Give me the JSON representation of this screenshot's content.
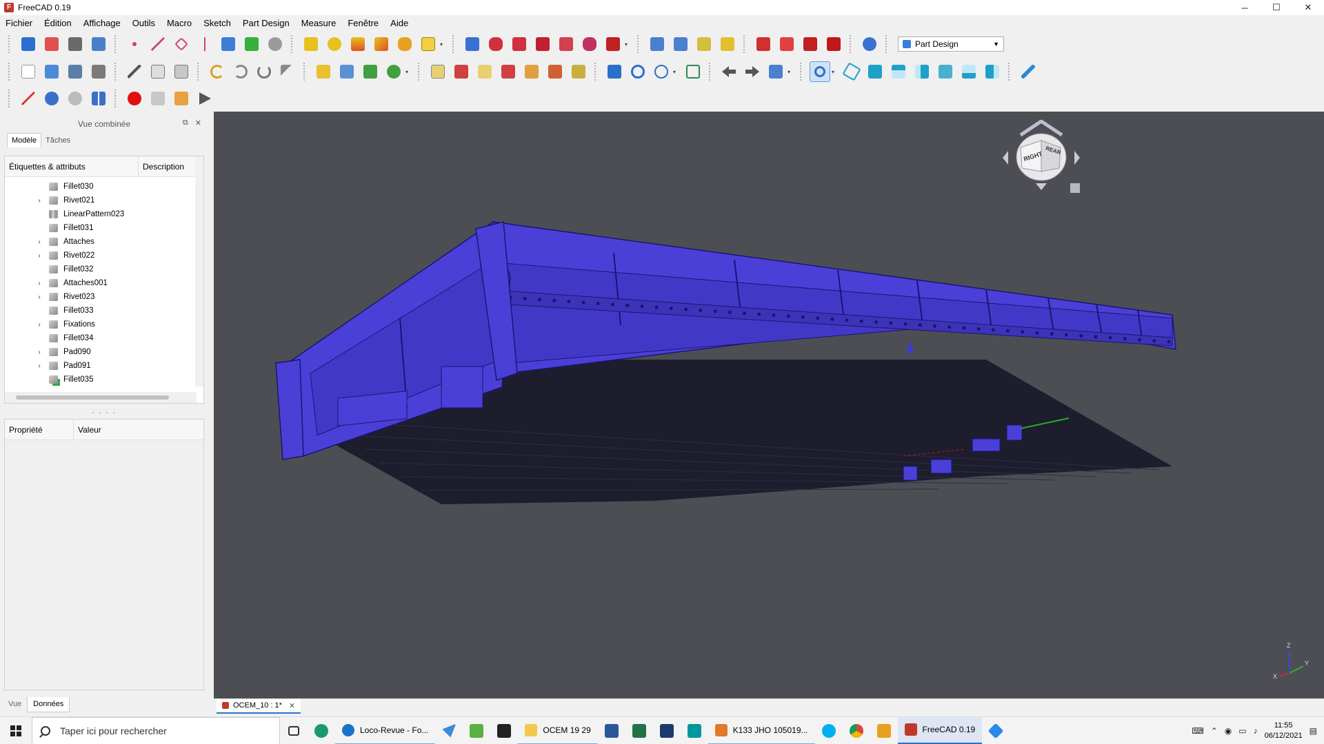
{
  "window": {
    "title": "FreeCAD 0.19",
    "min_icon": "─",
    "max_icon": "☐",
    "close_icon": "✕"
  },
  "menu": [
    "Fichier",
    "Édition",
    "Affichage",
    "Outils",
    "Macro",
    "Sketch",
    "Part Design",
    "Measure",
    "Fenêtre",
    "Aide"
  ],
  "workbench": {
    "selected": "Part Design"
  },
  "combo": {
    "title": "Vue combinée",
    "tabs": [
      "Modèle",
      "Tâches"
    ],
    "tree_columns": [
      "Étiquettes & attributs",
      "Description"
    ],
    "tree_items": [
      {
        "label": "Fillet030",
        "expandable": false,
        "icon": "fillet-icon"
      },
      {
        "label": "Rivet021",
        "expandable": true,
        "icon": "body-icon"
      },
      {
        "label": "LinearPattern023",
        "expandable": false,
        "icon": "linear-pattern-icon"
      },
      {
        "label": "Fillet031",
        "expandable": false,
        "icon": "fillet-icon"
      },
      {
        "label": "Attaches",
        "expandable": true,
        "icon": "body-icon"
      },
      {
        "label": "Rivet022",
        "expandable": true,
        "icon": "body-icon"
      },
      {
        "label": "Fillet032",
        "expandable": false,
        "icon": "fillet-icon"
      },
      {
        "label": "Attaches001",
        "expandable": true,
        "icon": "body-icon"
      },
      {
        "label": "Rivet023",
        "expandable": true,
        "icon": "body-icon"
      },
      {
        "label": "Fillet033",
        "expandable": false,
        "icon": "fillet-icon"
      },
      {
        "label": "Fixations",
        "expandable": true,
        "icon": "body-icon"
      },
      {
        "label": "Fillet034",
        "expandable": false,
        "icon": "fillet-icon"
      },
      {
        "label": "Pad090",
        "expandable": true,
        "icon": "pad-icon"
      },
      {
        "label": "Pad091",
        "expandable": true,
        "icon": "pad-icon"
      },
      {
        "label": "Fillet035",
        "expandable": false,
        "icon": "fillet-tip-icon"
      }
    ],
    "prop_columns": [
      "Propriété",
      "Valeur"
    ],
    "bottom_tabs": [
      "Vue",
      "Données"
    ]
  },
  "document_tab": {
    "label": "OCEM_10 : 1*"
  },
  "navcube": {
    "face_right": "RIGHT",
    "face_rear": "REAR"
  },
  "axis_labels": {
    "x": "X",
    "y": "Y",
    "z": "Z"
  },
  "taskbar": {
    "search_placeholder": "Taper ici pour rechercher",
    "apps": [
      {
        "label": "Loco-Revue - Fo...",
        "color": "#1a73c8"
      },
      {
        "label": "OCEM 19 29",
        "color": "#f2c94c"
      },
      {
        "label": "K133 JHO 105019...",
        "color": "#e07b2c"
      },
      {
        "label": "FreeCAD 0.19",
        "color": "#c0392b"
      }
    ],
    "clock_time": "11:55",
    "clock_date": "06/12/2021"
  },
  "colors": {
    "model_blue": "#4a40d8",
    "viewport_bg": "#4d4e54"
  }
}
